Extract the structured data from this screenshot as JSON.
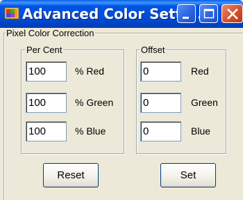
{
  "window": {
    "title": "Advanced Color Setti...",
    "app_icon": "colorful-app-icon",
    "controls": [
      "minimize-icon",
      "maximize-icon",
      "close-icon"
    ],
    "title_bar_color": "#0050dc",
    "close_color": "#d6512c"
  },
  "pixel_color_correction": {
    "label": "Pixel Color Correction",
    "per_cent": {
      "label": "Per Cent",
      "rows": [
        {
          "value": "100",
          "unit": "% Red"
        },
        {
          "value": "100",
          "unit": "% Green"
        },
        {
          "value": "100",
          "unit": "% Blue"
        }
      ]
    },
    "offset": {
      "label": "Offset",
      "rows": [
        {
          "value": "0",
          "unit": "Red"
        },
        {
          "value": "0",
          "unit": "Green"
        },
        {
          "value": "0",
          "unit": "Blue"
        }
      ]
    }
  },
  "buttons": {
    "reset_label": "Reset",
    "set_label": "Set"
  }
}
